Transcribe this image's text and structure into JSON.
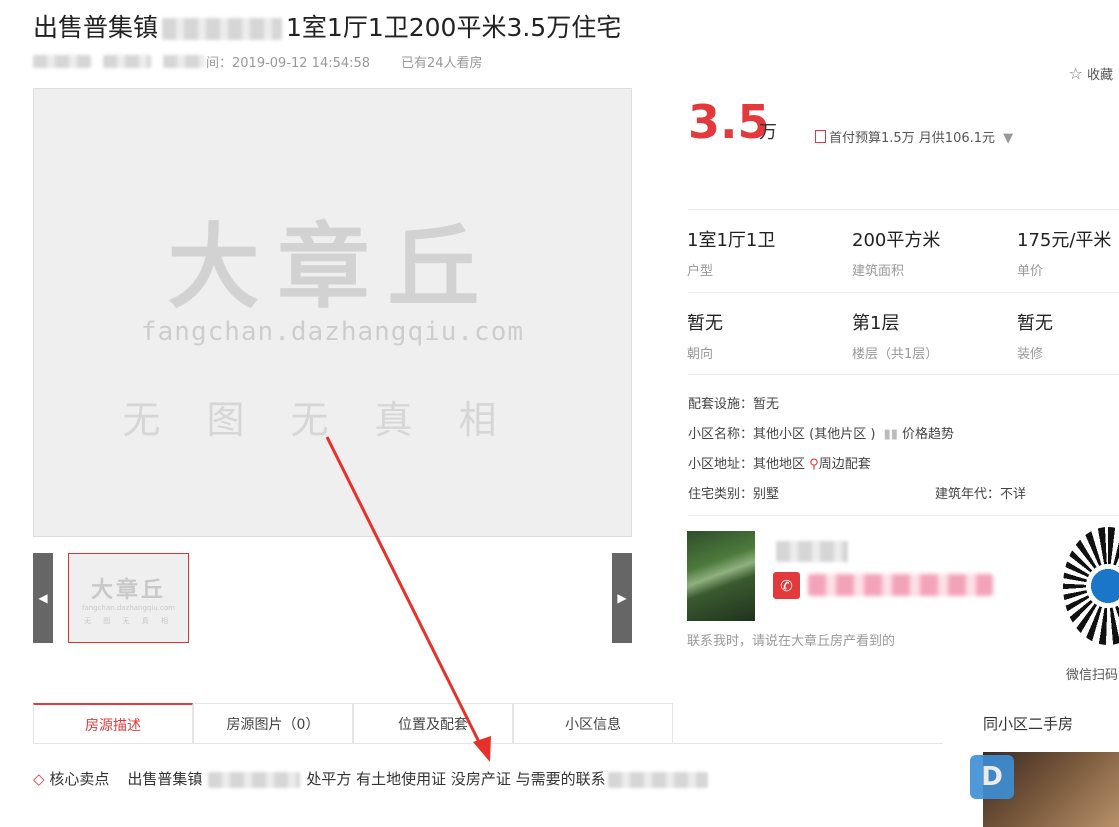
{
  "title": {
    "prefix": "出售普集镇",
    "suffix": "1室1厅1卫200平米3.5万住宅"
  },
  "meta": {
    "time_label": "间：2019-09-12 14:54:58",
    "viewers": "已有24人看房"
  },
  "favorite": {
    "icon": "star-icon",
    "label": "收藏"
  },
  "gallery": {
    "watermark_main": "大章丘",
    "watermark_url": "fangchan.dazhangqiu.com",
    "watermark_sub": "无图无真相",
    "thumb_main": "大章丘",
    "thumb_url": "fangchan.dazhangqiu.com",
    "thumb_sub": "无 图 无 真 相",
    "prev_icon": "◀",
    "next_icon": "▶"
  },
  "price": {
    "value": "3.5",
    "unit": "万",
    "budget": "首付预算1.5万 月供106.1元"
  },
  "specs": [
    {
      "value": "1室1厅1卫",
      "label": "户型"
    },
    {
      "value": "200平方米",
      "label": "建筑面积"
    },
    {
      "value": "175元/平米",
      "label": "单价"
    },
    {
      "value": "暂无",
      "label": "朝向"
    },
    {
      "value": "第1层",
      "label": "楼层（共1层）"
    },
    {
      "value": "暂无",
      "label": "装修"
    }
  ],
  "details": {
    "facilities": "配套设施：暂无",
    "community_label": "小区名称：",
    "community_name": "其他小区 (其他片区 )",
    "price_trend": "价格趋势",
    "address_label": "小区地址：",
    "address": "其他地区",
    "nearby": "周边配套",
    "house_type": "住宅类别：别墅",
    "build_year": "建筑年代：不详"
  },
  "contact": {
    "note": "联系我时，请说在大章丘房产看到的",
    "wechat_label": "微信扫码"
  },
  "tabs": [
    "房源描述",
    "房源图片（0）",
    "位置及配套",
    "小区信息"
  ],
  "same_community": "同小区二手房",
  "core": {
    "label": "核心卖点",
    "text_a": "出售普集镇",
    "text_b": "处平方  有土地使用证 没房产证  与需要的联系"
  },
  "colors": {
    "accent": "#e4393c",
    "arrow": "#e8302a"
  }
}
